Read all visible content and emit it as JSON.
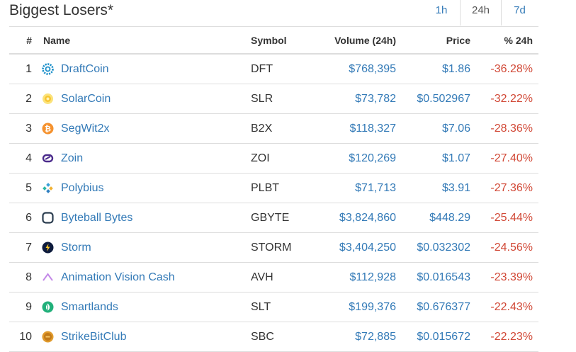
{
  "title": "Biggest Losers*",
  "tabs": [
    {
      "label": "1h"
    },
    {
      "label": "24h",
      "active": true
    },
    {
      "label": "7d"
    }
  ],
  "table": {
    "headers": {
      "rank": "#",
      "name": "Name",
      "symbol": "Symbol",
      "volume": "Volume (24h)",
      "price": "Price",
      "change": "% 24h"
    },
    "rows": [
      {
        "rank": "1",
        "name": "DraftCoin",
        "symbol": "DFT",
        "volume": "$768,395",
        "price": "$1.86",
        "change": "-36.28%",
        "icon": "draftcoin-icon"
      },
      {
        "rank": "2",
        "name": "SolarCoin",
        "symbol": "SLR",
        "volume": "$73,782",
        "price": "$0.502967",
        "change": "-32.22%",
        "icon": "solarcoin-icon"
      },
      {
        "rank": "3",
        "name": "SegWit2x",
        "symbol": "B2X",
        "volume": "$118,327",
        "price": "$7.06",
        "change": "-28.36%",
        "icon": "segwit2x-icon"
      },
      {
        "rank": "4",
        "name": "Zoin",
        "symbol": "ZOI",
        "volume": "$120,269",
        "price": "$1.07",
        "change": "-27.40%",
        "icon": "zoin-icon"
      },
      {
        "rank": "5",
        "name": "Polybius",
        "symbol": "PLBT",
        "volume": "$71,713",
        "price": "$3.91",
        "change": "-27.36%",
        "icon": "polybius-icon"
      },
      {
        "rank": "6",
        "name": "Byteball Bytes",
        "symbol": "GBYTE",
        "volume": "$3,824,860",
        "price": "$448.29",
        "change": "-25.44%",
        "icon": "byteball-icon"
      },
      {
        "rank": "7",
        "name": "Storm",
        "symbol": "STORM",
        "volume": "$3,404,250",
        "price": "$0.032302",
        "change": "-24.56%",
        "icon": "storm-icon"
      },
      {
        "rank": "8",
        "name": "Animation Vision Cash",
        "symbol": "AVH",
        "volume": "$112,928",
        "price": "$0.016543",
        "change": "-23.39%",
        "icon": "animation-vision-cash-icon"
      },
      {
        "rank": "9",
        "name": "Smartlands",
        "symbol": "SLT",
        "volume": "$199,376",
        "price": "$0.676377",
        "change": "-22.43%",
        "icon": "smartlands-icon"
      },
      {
        "rank": "10",
        "name": "StrikeBitClub",
        "symbol": "SBC",
        "volume": "$72,885",
        "price": "$0.015672",
        "change": "-22.23%",
        "icon": "strikebitclub-icon"
      }
    ]
  },
  "colors": {
    "link": "#337ab7",
    "negative": "#d14836",
    "border": "#dddddd"
  }
}
